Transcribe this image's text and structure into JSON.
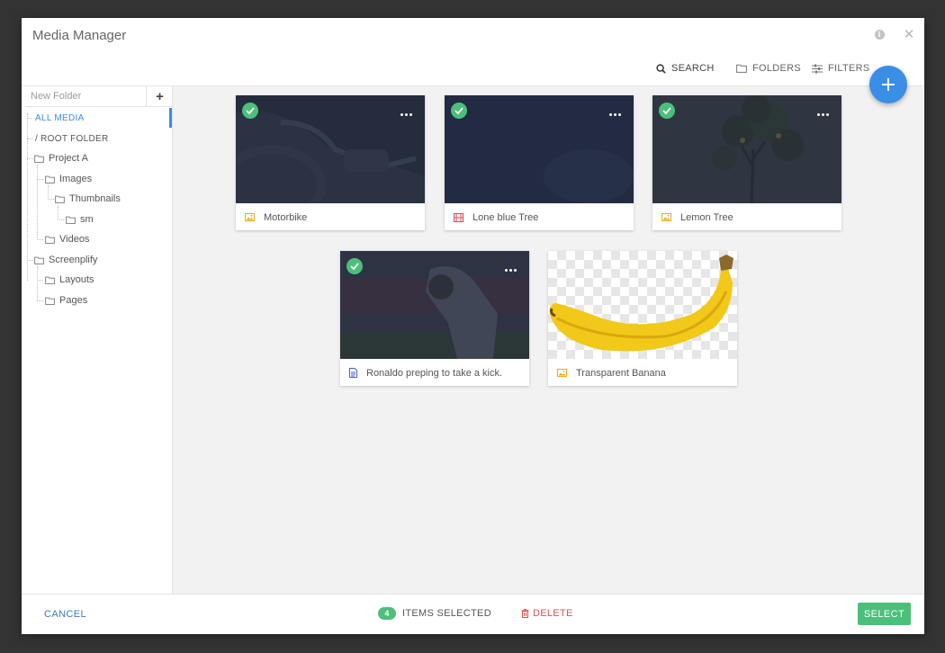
{
  "window": {
    "title": "Media Manager"
  },
  "header": {
    "info_icon": "info-icon",
    "close_icon": "close-icon"
  },
  "toolbar": {
    "search_label": "SEARCH",
    "folders_label": "FOLDERS",
    "filters_label": "FILTERS",
    "add_icon": "plus-icon"
  },
  "sidebar": {
    "new_folder_placeholder": "New Folder",
    "add_folder_icon": "+",
    "tree": [
      {
        "label": "ALL MEDIA",
        "active": true
      },
      {
        "label": "/ ROOT FOLDER"
      },
      {
        "label": "Project A"
      },
      {
        "label": "Images"
      },
      {
        "label": "Thumbnails"
      },
      {
        "label": "sm"
      },
      {
        "label": "Videos"
      },
      {
        "label": "Screenplify"
      },
      {
        "label": "Layouts"
      },
      {
        "label": "Pages"
      }
    ]
  },
  "media": [
    {
      "name": "Motorbike",
      "type": "image",
      "selected": true
    },
    {
      "name": "Lone blue Tree",
      "type": "video",
      "selected": true
    },
    {
      "name": "Lemon Tree",
      "type": "image",
      "selected": true
    },
    {
      "name": "Ronaldo preping to take a kick.",
      "type": "document",
      "selected": true
    },
    {
      "name": "Transparent Banana",
      "type": "image",
      "selected": false
    }
  ],
  "colors": {
    "accent": "#3a8ee6",
    "success": "#4cbf7a",
    "danger": "#d9534f",
    "image_icon": "#f5a623",
    "video_icon": "#e0445a",
    "doc_icon": "#4a5ad6"
  },
  "footer": {
    "cancel_label": "CANCEL",
    "selected_count": "4",
    "selected_label": "ITEMS SELECTED",
    "delete_label": "DELETE",
    "select_label": "SELECT"
  }
}
